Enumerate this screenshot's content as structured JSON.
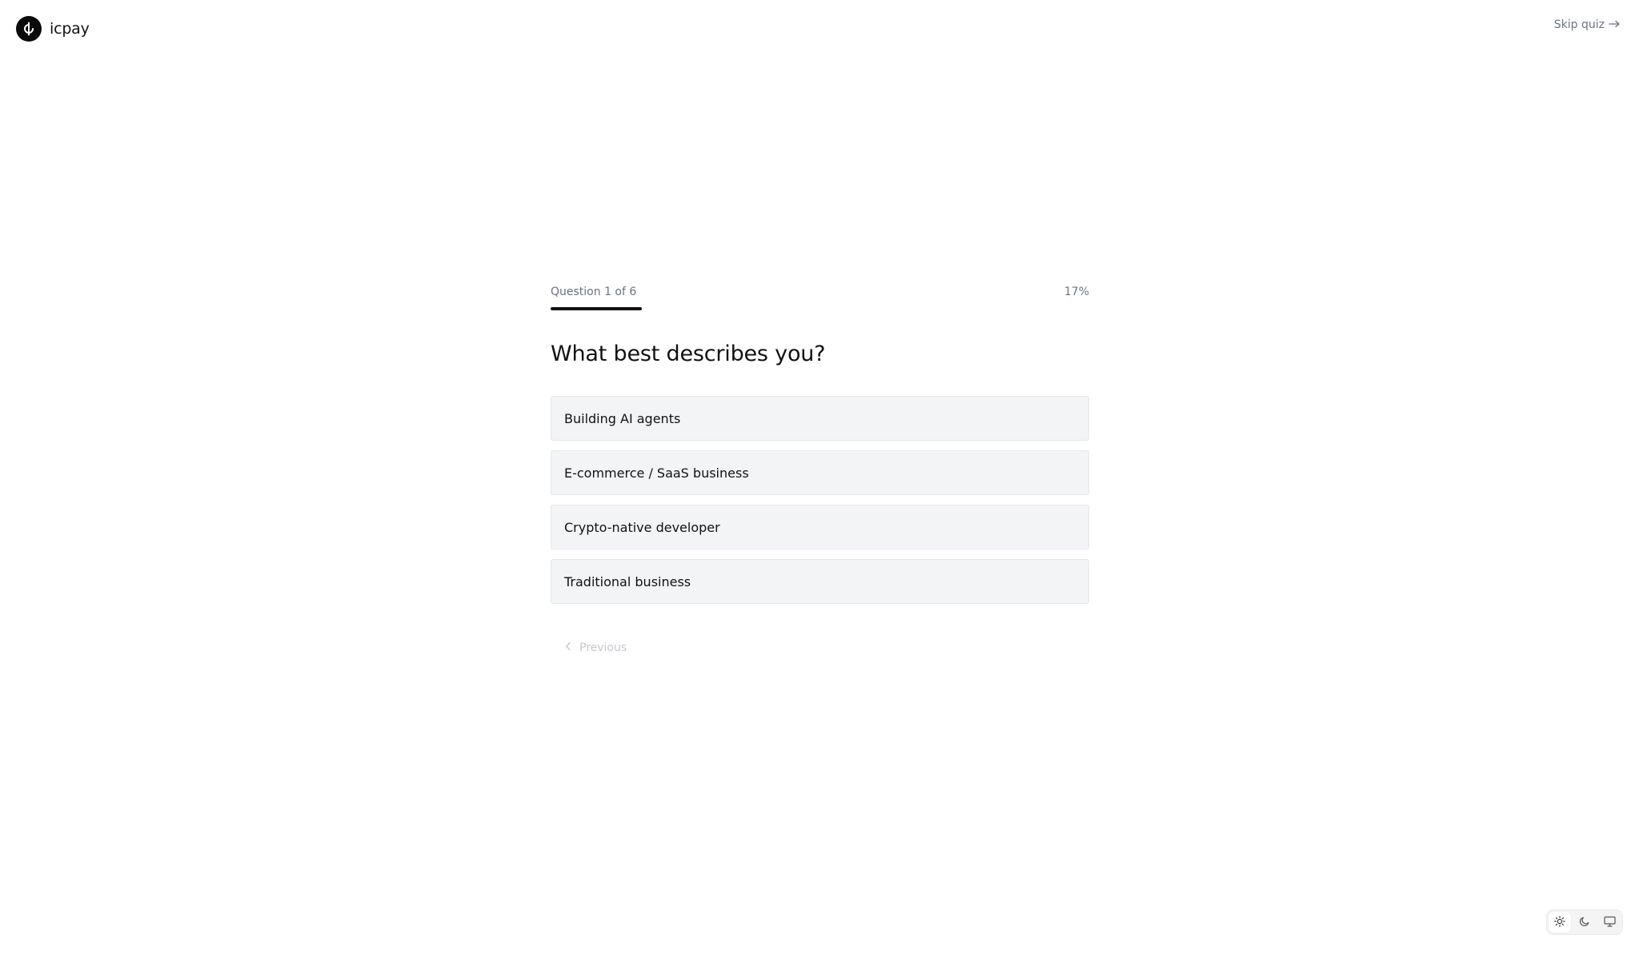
{
  "header": {
    "logo_text": "icpay",
    "logo_icon": "icpay-logo-icon",
    "skip_label": "Skip quiz",
    "skip_icon": "arrow-right-icon"
  },
  "quiz": {
    "progress_label": "Question 1 of 6",
    "progress_percent_label": "17%",
    "progress_value": 0.17,
    "question": "What best describes you?",
    "options": [
      {
        "label": "Building AI agents"
      },
      {
        "label": "E-commerce / SaaS business"
      },
      {
        "label": "Crypto-native developer"
      },
      {
        "label": "Traditional business"
      }
    ],
    "previous_label": "Previous",
    "previous_icon": "chevron-left-icon"
  },
  "theme_switcher": {
    "selected": "light",
    "options": [
      "light",
      "dark",
      "system"
    ],
    "icons": [
      "sun-icon",
      "moon-icon",
      "monitor-icon"
    ]
  },
  "colors": {
    "text": "#111111",
    "muted": "#6b7280",
    "option_bg": "#f3f4f6",
    "progress_fill": "#111111"
  }
}
